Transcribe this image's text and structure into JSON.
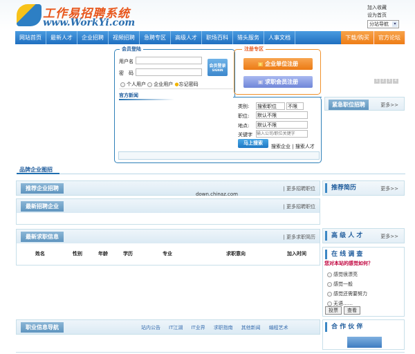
{
  "header": {
    "logo_title": "工作易招聘系统",
    "logo_url": "www.WorkYi.com",
    "add_favorite": "加入收藏",
    "set_home": "设为首页",
    "substation_select": "分站导航"
  },
  "nav": {
    "items": [
      "网站首页",
      "最新人才",
      "企业招聘",
      "视频招聘",
      "急聘专区",
      "高级人才",
      "职场百科",
      "猎头服务",
      "人事文档"
    ],
    "right_items": [
      "下载/购买",
      "官方论坛"
    ]
  },
  "login": {
    "title": "会员登陆",
    "username_label": "用户名",
    "password_label": "密　码",
    "username_value": "",
    "password_value": "",
    "login_button": "会员登录",
    "login_button_sub": "SIGNIN",
    "personal_user": "个人用户",
    "company_user": "企业用户",
    "forgot_password": "忘记密码"
  },
  "register": {
    "title": "注册专区",
    "company_register": "企业单位注册",
    "member_register": "求职会员注册"
  },
  "news": {
    "title": "官方新闻"
  },
  "search": {
    "category_label": "类别:",
    "category_value": "搜索职位",
    "category_value2": "不限",
    "position_label": "职位:",
    "position_value": "默认不限",
    "location_label": "地点:",
    "location_value": "默认不限",
    "keyword_label": "关键字",
    "keyword_placeholder": "输入公司/职位关键字",
    "search_button": "马上搜索",
    "search_company": "搜索企业",
    "search_talent": "搜索人才",
    "separator": "|"
  },
  "pager": [
    "1",
    "2",
    "3",
    "4"
  ],
  "urgent": {
    "title": "紧急职位招聘",
    "more": "更多>>"
  },
  "brand": {
    "title": "品牌企业图招"
  },
  "watermark": "down.chinaz.com",
  "sections": {
    "recommend_jobs": {
      "title": "推荐企业招聘",
      "more": "| 更多招聘职位"
    },
    "latest_companies": {
      "title": "最新招聘企业",
      "more": "| 更多招聘职位"
    },
    "latest_seekers": {
      "title": "最新求职信息",
      "more": "| 更多求职简历",
      "columns": [
        "姓名",
        "性别",
        "年龄",
        "学历",
        "专业",
        "求职意向",
        "加入时间"
      ]
    },
    "career_nav": {
      "title": "职业信息导航",
      "links": [
        "站内公告",
        "IT江湖",
        "IT业界",
        "求职指南",
        "其他新闻",
        "编程艺术"
      ]
    }
  },
  "sidebar": {
    "recommend_resume": {
      "title": "推荐简历",
      "more": "更多>>"
    },
    "senior_talent": {
      "title": "高 级 人 才",
      "more": "更多>>"
    },
    "survey": {
      "title": "在 线 调 查",
      "question": "您对本站的感觉如何？",
      "options": [
        "感觉很漂亮",
        "感觉一般",
        "感觉还需要努力",
        "无语……"
      ],
      "vote_button": "投票",
      "view_button": "查看"
    },
    "partners": {
      "title": "合 作 伙 伴",
      "partner_logo": "工作易招聘网"
    }
  },
  "colors": {
    "nav_blue": "#2b7fcf",
    "accent_orange": "#ee7d16",
    "survey_red": "#c0003c",
    "link_blue": "#1f5c9c"
  }
}
